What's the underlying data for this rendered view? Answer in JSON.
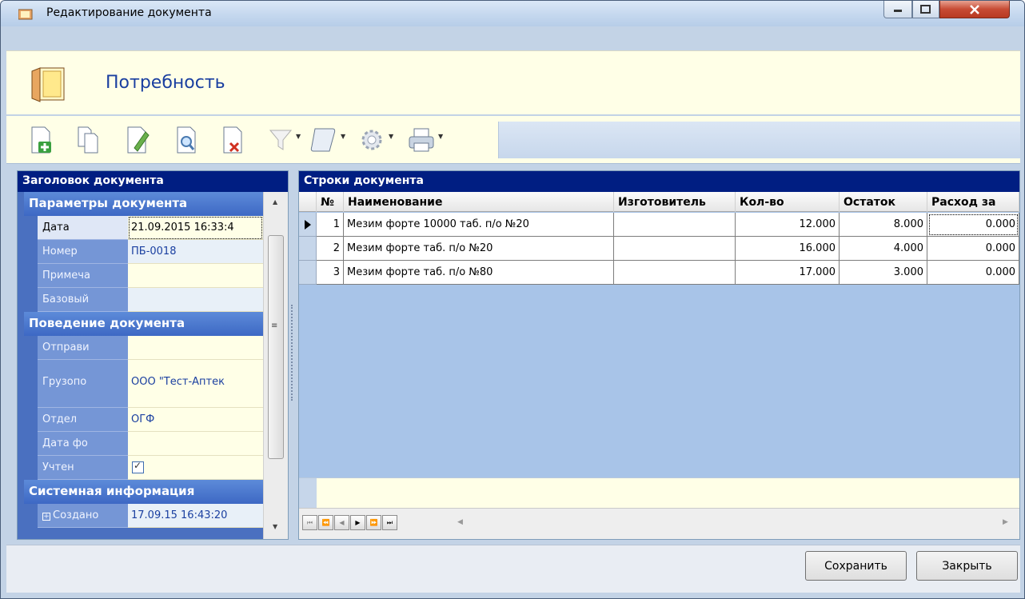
{
  "window": {
    "title": "Редактирование документа"
  },
  "header": {
    "title": "Потребность"
  },
  "toolbar": {
    "buttons": [
      {
        "icon": "add-document-icon"
      },
      {
        "icon": "copy-document-icon"
      },
      {
        "icon": "edit-document-icon"
      },
      {
        "icon": "preview-document-icon"
      },
      {
        "icon": "delete-document-icon"
      },
      {
        "icon": "filter-icon"
      },
      {
        "icon": "script-icon"
      },
      {
        "icon": "gear-icon"
      },
      {
        "icon": "printer-icon"
      }
    ]
  },
  "left_panel": {
    "caption": "Заголовок документа",
    "groups": [
      {
        "title": "Параметры документа",
        "rows": [
          {
            "label": "Дата",
            "value": "21.09.2015 16:33:4"
          },
          {
            "label": "Номер",
            "value": "ПБ-0018"
          },
          {
            "label": "Примеча",
            "value": ""
          },
          {
            "label": "Базовый",
            "value": ""
          }
        ]
      },
      {
        "title": "Поведение документа",
        "rows": [
          {
            "label": "Отправи",
            "value": ""
          },
          {
            "label": "Грузопо",
            "value": "ООО \"Тест-Аптек"
          },
          {
            "label": "Отдел",
            "value": "ОГФ"
          },
          {
            "label": "Дата фо",
            "value": ""
          },
          {
            "label": "Учтен",
            "checked": true
          }
        ]
      },
      {
        "title": "Системная информация",
        "rows": [
          {
            "label": "Создано",
            "value": "17.09.15 16:43:20"
          }
        ]
      }
    ]
  },
  "right_panel": {
    "caption": "Строки документа",
    "columns": [
      "№",
      "Наименование",
      "Изготовитель",
      "Кол-во",
      "Остаток",
      "Расход за"
    ],
    "rows": [
      {
        "n": "1",
        "name": "Мезим форте 10000 таб. п/о №20",
        "maker": "",
        "qty": "12.000",
        "rest": "8.000",
        "consumption": "0.000"
      },
      {
        "n": "2",
        "name": "Мезим форте таб. п/о №20",
        "maker": "",
        "qty": "16.000",
        "rest": "4.000",
        "consumption": "0.000"
      },
      {
        "n": "3",
        "name": "Мезим форте таб. п/о №80",
        "maker": "",
        "qty": "17.000",
        "rest": "3.000",
        "consumption": "0.000"
      }
    ],
    "nav": {
      "first": "⏮",
      "prev_page": "⏪",
      "prev": "◀",
      "next": "▶",
      "next_page": "⏩",
      "last": "⏭"
    }
  },
  "bottom": {
    "save_label": "Сохранить",
    "close_label": "Закрыть"
  },
  "colors": {
    "caption_bg": "#001e82",
    "header_bg": "#ffffe7",
    "group_bg": "#4a70c0",
    "grid_bg": "#a8c4e8"
  }
}
